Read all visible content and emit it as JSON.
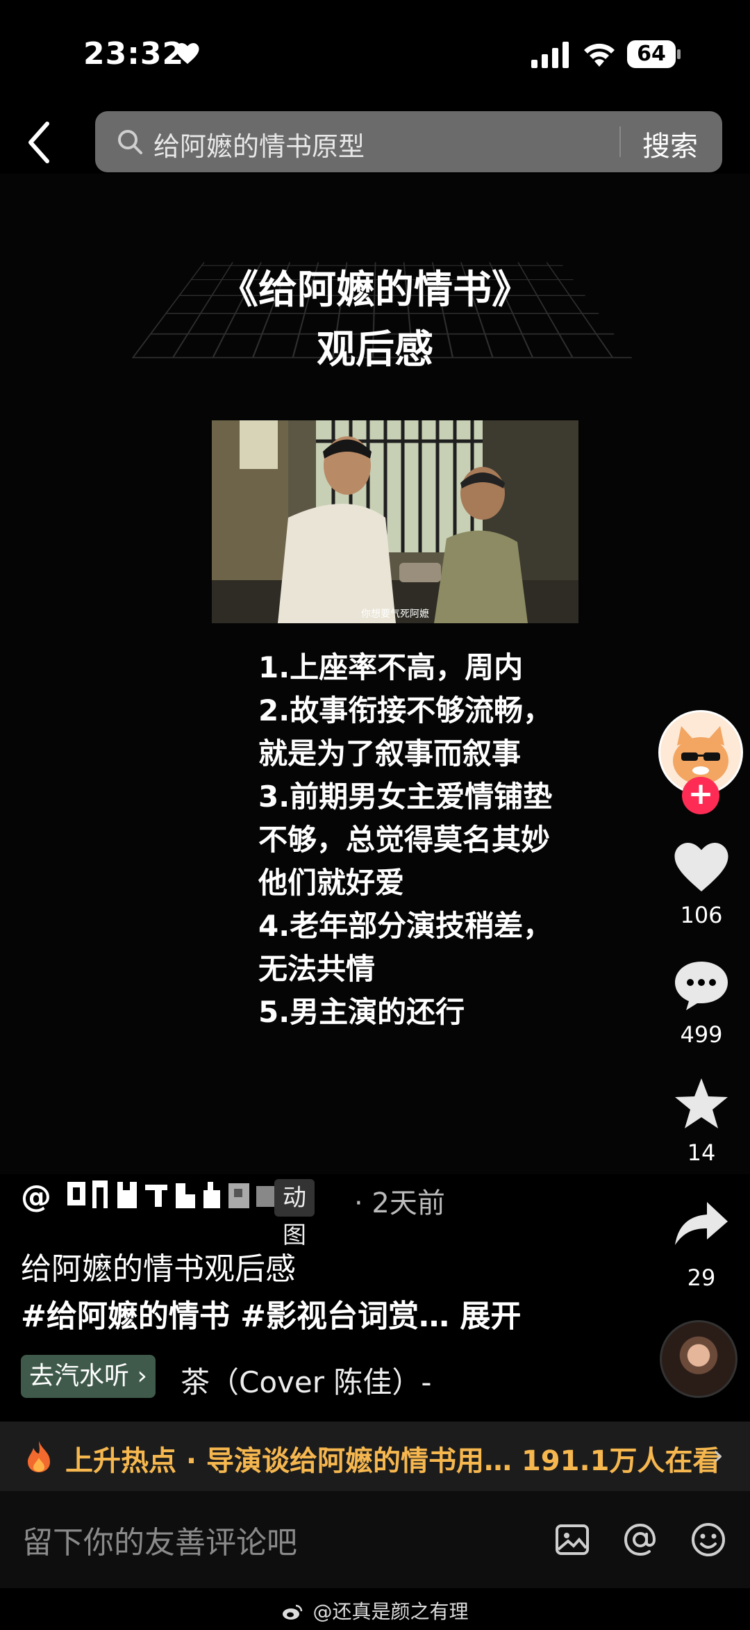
{
  "status_bar": {
    "time": "23:32",
    "battery": "64",
    "icons": [
      "heart-icon",
      "signal-icon",
      "wifi-icon",
      "battery-icon"
    ]
  },
  "search": {
    "query": "给阿嬷的情书原型",
    "button_label": "搜索"
  },
  "poster": {
    "title_line1": "《给阿嬷的情书》",
    "title_line2": "观后感",
    "still_subtitle": "你想要气死阿嬷",
    "notes": [
      "1.上座率不高，周内",
      "2.故事衔接不够流畅，",
      "就是为了叙事而叙事",
      "3.前期男女主爱情铺垫",
      "不够，总觉得莫名其妙",
      "他们就好爱",
      "4.老年部分演技稍差，",
      "无法共情",
      "5.男主演的还行"
    ]
  },
  "rail": {
    "likes": "106",
    "comments": "499",
    "favorites": "14",
    "shares": "29",
    "follow_symbol": "+"
  },
  "post": {
    "author_prefix": "@",
    "tag": "动图",
    "time_ago": "· 2天前",
    "caption": "给阿嬷的情书观后感",
    "hashtags": "#给阿嬷的情书 #影视台词赏…",
    "expand_label": "展开",
    "music_pill": "去汽水听 ›",
    "music_title": "茶（Cover 陈佳）-"
  },
  "hot": {
    "text": "上升热点 · 导演谈给阿嬷的情书用… 191.1万人在看",
    "chevron": "›"
  },
  "comment_bar": {
    "placeholder": "留下你的友善评论吧"
  },
  "watermark": "@还真是颜之有理",
  "colors": {
    "background": "#000000",
    "search_bg": "#6b6b6b",
    "follow_red": "#fe2c55",
    "hot_text": "#f6b74f",
    "music_pill_bg": "#3f5a4b"
  }
}
